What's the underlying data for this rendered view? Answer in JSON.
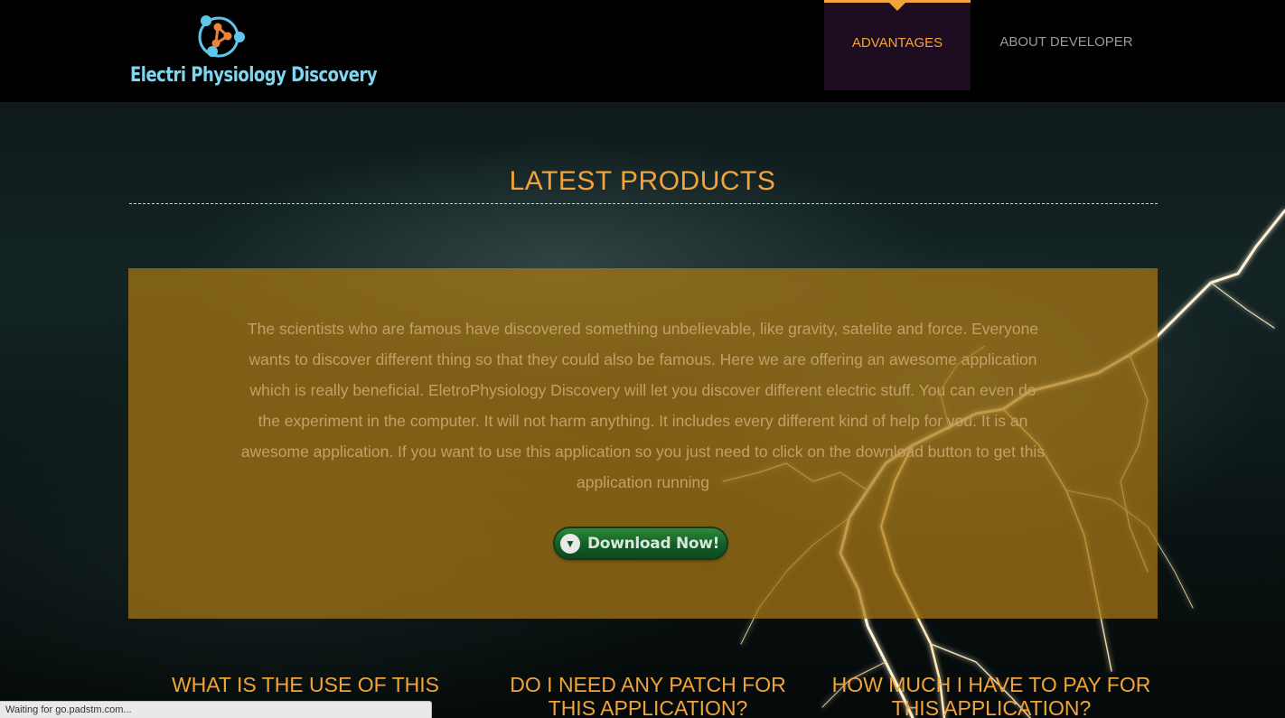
{
  "header": {
    "logo_text": "Electri Physiology Discovery",
    "nav": [
      {
        "label": "ADVANTAGES",
        "active": true
      },
      {
        "label": "ABOUT DEVELOPER",
        "active": false
      }
    ]
  },
  "main": {
    "section_title": "LATEST PRODUCTS",
    "description": "The scientists who are famous have discovered something unbelievable, like gravity, satelite and force. Everyone wants to discover different thing so that they could also be famous. Here we are offering an awesome application which is really beneficial. EletroPhysiology Discovery will let you discover different electric stuff. You can even do the experiment in the computer. It will not harm anything. It includes every different kind of help for you. It is an awesome application. If you want to use this application so you just need to click on the download button to get this application running",
    "download_label": "Download Now!",
    "faq_titles": [
      "WHAT IS THE USE OF THIS",
      "DO I NEED ANY PATCH FOR THIS APPLICATION?",
      "HOW MUCH I HAVE TO PAY FOR THIS APPLICATION?"
    ]
  },
  "status_bar": {
    "text": "Waiting for go.padstm.com..."
  },
  "colors": {
    "accent": "#f2a33a",
    "active_nav_bg": "#1e0c20",
    "logo_text": "#7fd6ef",
    "panel": "#aa7814"
  },
  "icons": [
    "atom-logo-icon",
    "download-arrow-icon",
    "lightning-bolt-image"
  ]
}
